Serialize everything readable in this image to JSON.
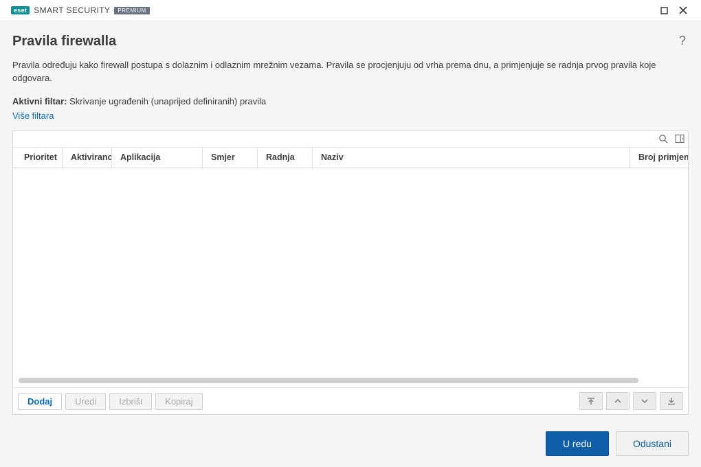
{
  "app": {
    "brand_badge": "eset",
    "brand_text_bold": "SMART",
    "brand_text_light": "SECURITY",
    "premium": "PREMIUM"
  },
  "page": {
    "title": "Pravila firewalla",
    "description": "Pravila određuju kako firewall postupa s dolaznim i odlaznim mrežnim vezama. Pravila se procjenjuju od vrha prema dnu, a primjenjuje se radnja prvog pravila koje odgovara.",
    "filter_label": "Aktivni filtar:",
    "filter_value": "Skrivanje ugrađenih (unaprijed definiranih) pravila",
    "more_filter": "Više filtara"
  },
  "columns": {
    "priority": "Prioritet",
    "enabled": "Aktivirano",
    "application": "Aplikacija",
    "direction": "Smjer",
    "action": "Radnja",
    "name": "Naziv",
    "hits": "Broj primjena"
  },
  "actions": {
    "add": "Dodaj",
    "edit": "Uredi",
    "delete": "Izbriši",
    "copy": "Kopiraj"
  },
  "footer": {
    "ok": "U redu",
    "cancel": "Odustani"
  }
}
